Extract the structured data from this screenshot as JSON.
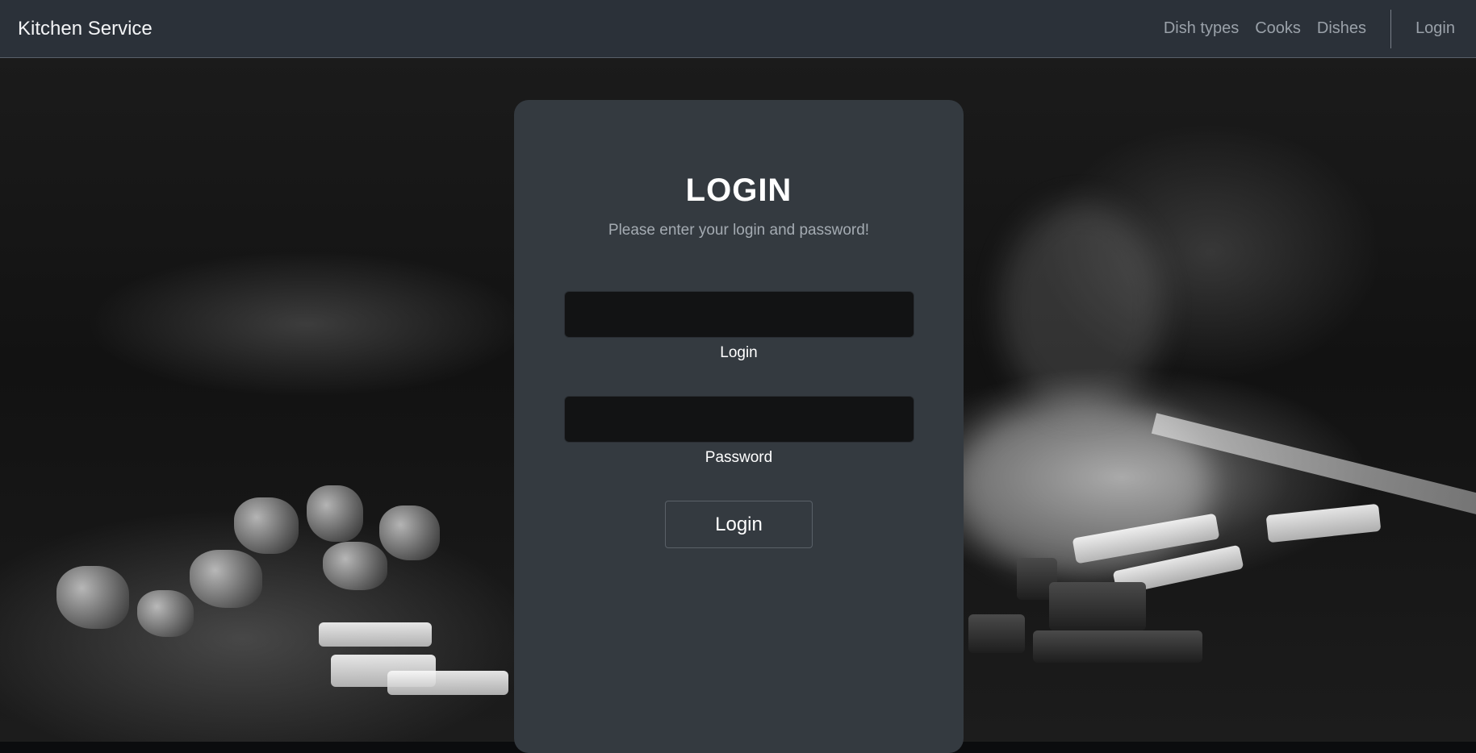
{
  "navbar": {
    "brand": "Kitchen Service",
    "links": [
      "Dish types",
      "Cooks",
      "Dishes"
    ],
    "login": "Login"
  },
  "login_card": {
    "title": "LOGIN",
    "subtitle": "Please enter your login and password!",
    "login_field": {
      "value": "",
      "label": "Login"
    },
    "password_field": {
      "value": "",
      "label": "Password"
    },
    "submit_label": "Login"
  },
  "colors": {
    "navbar_bg": "#2b3139",
    "card_bg": "#343a40",
    "input_bg": "#121314",
    "muted_text": "#a4abb2"
  }
}
